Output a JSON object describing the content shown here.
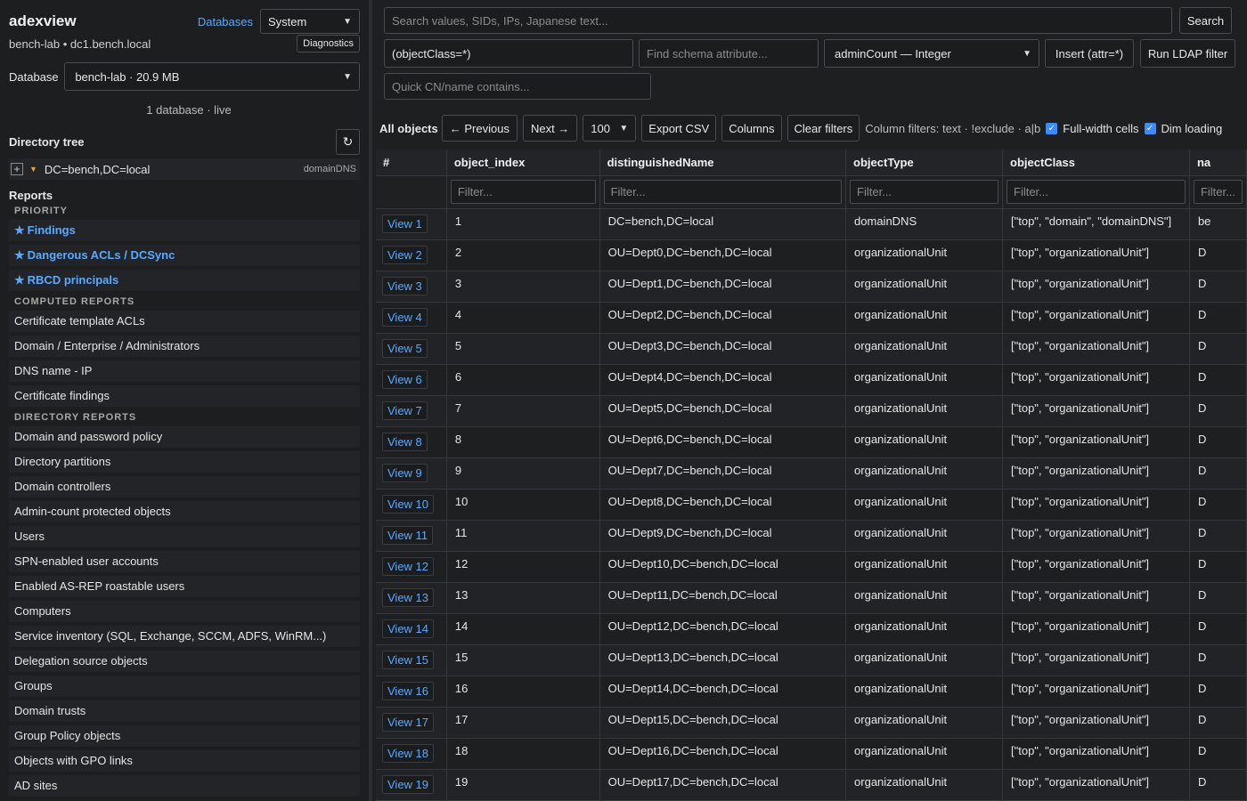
{
  "sidebar": {
    "brand": "adexview",
    "databases_link": "Databases",
    "theme_select": "System",
    "host": "bench-lab • dc1.bench.local",
    "diagnostics": "Diagnostics",
    "database_label": "Database",
    "database_select": "bench-lab · 20.9 MB",
    "db_status": "1 database · live",
    "tree_title": "Directory tree",
    "refresh_icon": "↻",
    "tree_node": {
      "dn": "DC=bench,DC=local",
      "type": "domainDNS"
    },
    "reports_title": "Reports",
    "priority_label": "PRIORITY",
    "priority": [
      "Findings",
      "Dangerous ACLs / DCSync",
      "RBCD principals"
    ],
    "computed_label": "COMPUTED REPORTS",
    "computed": [
      "Certificate template ACLs",
      "Domain / Enterprise / Administrators",
      "DNS name - IP",
      "Certificate findings"
    ],
    "directory_label": "DIRECTORY REPORTS",
    "directory": [
      "Domain and password policy",
      "Directory partitions",
      "Domain controllers",
      "Admin-count protected objects",
      "Users",
      "SPN-enabled user accounts",
      "Enabled AS-REP roastable users",
      "Computers",
      "Service inventory (SQL, Exchange, SCCM, ADFS, WinRM...)",
      "Delegation source objects",
      "Groups",
      "Domain trusts",
      "Group Policy objects",
      "Objects with GPO links",
      "AD sites"
    ]
  },
  "search": {
    "placeholder": "Search values, SIDs, IPs, Japanese text...",
    "button": "Search",
    "ldap_value": "(objectClass=*)",
    "schema_placeholder": "Find schema attribute...",
    "attr_select": "adminCount — Integer",
    "insert_button": "Insert (attr=*)",
    "run_button": "Run LDAP filter",
    "quick_placeholder": "Quick CN/name contains..."
  },
  "toolbar": {
    "all_objects": "All objects",
    "previous": "← Previous",
    "next": "Next →",
    "page_size": "100",
    "export": "Export CSV",
    "columns": "Columns",
    "clear": "Clear filters",
    "hint": "Column filters: text · !exclude · a|b",
    "full_width": "Full-width cells",
    "dim": "Dim loading"
  },
  "table": {
    "headers": [
      "#",
      "object_index",
      "distinguishedName",
      "objectType",
      "objectClass",
      "na"
    ],
    "filter_placeholder": "Filter...",
    "rows": [
      {
        "view": "View 1",
        "idx": "1",
        "dn": "DC=bench,DC=local",
        "type": "domainDNS",
        "cls": "[\"top\", \"domain\", \"domainDNS\"]",
        "na": "be"
      },
      {
        "view": "View 2",
        "idx": "2",
        "dn": "OU=Dept0,DC=bench,DC=local",
        "type": "organizationalUnit",
        "cls": "[\"top\", \"organizationalUnit\"]",
        "na": "D"
      },
      {
        "view": "View 3",
        "idx": "3",
        "dn": "OU=Dept1,DC=bench,DC=local",
        "type": "organizationalUnit",
        "cls": "[\"top\", \"organizationalUnit\"]",
        "na": "D"
      },
      {
        "view": "View 4",
        "idx": "4",
        "dn": "OU=Dept2,DC=bench,DC=local",
        "type": "organizationalUnit",
        "cls": "[\"top\", \"organizationalUnit\"]",
        "na": "D"
      },
      {
        "view": "View 5",
        "idx": "5",
        "dn": "OU=Dept3,DC=bench,DC=local",
        "type": "organizationalUnit",
        "cls": "[\"top\", \"organizationalUnit\"]",
        "na": "D"
      },
      {
        "view": "View 6",
        "idx": "6",
        "dn": "OU=Dept4,DC=bench,DC=local",
        "type": "organizationalUnit",
        "cls": "[\"top\", \"organizationalUnit\"]",
        "na": "D"
      },
      {
        "view": "View 7",
        "idx": "7",
        "dn": "OU=Dept5,DC=bench,DC=local",
        "type": "organizationalUnit",
        "cls": "[\"top\", \"organizationalUnit\"]",
        "na": "D"
      },
      {
        "view": "View 8",
        "idx": "8",
        "dn": "OU=Dept6,DC=bench,DC=local",
        "type": "organizationalUnit",
        "cls": "[\"top\", \"organizationalUnit\"]",
        "na": "D"
      },
      {
        "view": "View 9",
        "idx": "9",
        "dn": "OU=Dept7,DC=bench,DC=local",
        "type": "organizationalUnit",
        "cls": "[\"top\", \"organizationalUnit\"]",
        "na": "D"
      },
      {
        "view": "View 10",
        "idx": "10",
        "dn": "OU=Dept8,DC=bench,DC=local",
        "type": "organizationalUnit",
        "cls": "[\"top\", \"organizationalUnit\"]",
        "na": "D"
      },
      {
        "view": "View 11",
        "idx": "11",
        "dn": "OU=Dept9,DC=bench,DC=local",
        "type": "organizationalUnit",
        "cls": "[\"top\", \"organizationalUnit\"]",
        "na": "D"
      },
      {
        "view": "View 12",
        "idx": "12",
        "dn": "OU=Dept10,DC=bench,DC=local",
        "type": "organizationalUnit",
        "cls": "[\"top\", \"organizationalUnit\"]",
        "na": "D"
      },
      {
        "view": "View 13",
        "idx": "13",
        "dn": "OU=Dept11,DC=bench,DC=local",
        "type": "organizationalUnit",
        "cls": "[\"top\", \"organizationalUnit\"]",
        "na": "D"
      },
      {
        "view": "View 14",
        "idx": "14",
        "dn": "OU=Dept12,DC=bench,DC=local",
        "type": "organizationalUnit",
        "cls": "[\"top\", \"organizationalUnit\"]",
        "na": "D"
      },
      {
        "view": "View 15",
        "idx": "15",
        "dn": "OU=Dept13,DC=bench,DC=local",
        "type": "organizationalUnit",
        "cls": "[\"top\", \"organizationalUnit\"]",
        "na": "D"
      },
      {
        "view": "View 16",
        "idx": "16",
        "dn": "OU=Dept14,DC=bench,DC=local",
        "type": "organizationalUnit",
        "cls": "[\"top\", \"organizationalUnit\"]",
        "na": "D"
      },
      {
        "view": "View 17",
        "idx": "17",
        "dn": "OU=Dept15,DC=bench,DC=local",
        "type": "organizationalUnit",
        "cls": "[\"top\", \"organizationalUnit\"]",
        "na": "D"
      },
      {
        "view": "View 18",
        "idx": "18",
        "dn": "OU=Dept16,DC=bench,DC=local",
        "type": "organizationalUnit",
        "cls": "[\"top\", \"organizationalUnit\"]",
        "na": "D"
      },
      {
        "view": "View 19",
        "idx": "19",
        "dn": "OU=Dept17,DC=bench,DC=local",
        "type": "organizationalUnit",
        "cls": "[\"top\", \"organizationalUnit\"]",
        "na": "D"
      }
    ]
  }
}
